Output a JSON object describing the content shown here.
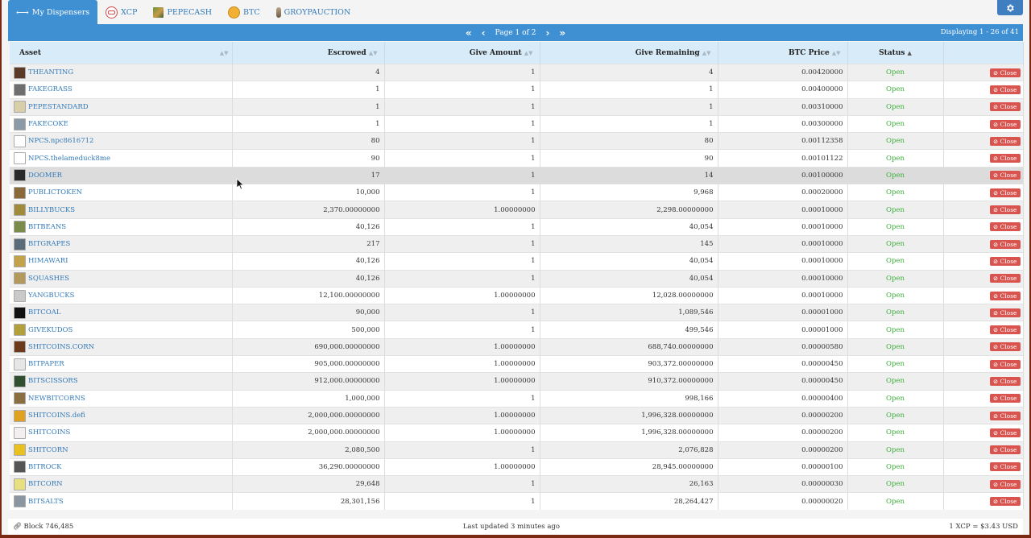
{
  "tabs": [
    {
      "label": "My Dispensers",
      "icon": "arrows-icon",
      "active": true
    },
    {
      "label": "XCP",
      "icon": "xcp-icon"
    },
    {
      "label": "PEPECASH",
      "icon": "pepecash-icon"
    },
    {
      "label": "BTC",
      "icon": "btc-icon"
    },
    {
      "label": "GROYPAUCTION",
      "icon": "groypauction-icon"
    }
  ],
  "pager": {
    "page_label": "Page 1 of 2",
    "displaying": "Displaying 1 - 26 of 41"
  },
  "columns": [
    "Asset",
    "Escrowed",
    "Give Amount",
    "Give Remaining",
    "BTC Price",
    "Status"
  ],
  "close_label": "Close",
  "rows": [
    {
      "asset": "THEANTING",
      "escrowed": "4",
      "give": "1",
      "remaining": "4",
      "price": "0.00420000",
      "status": "Open",
      "color": "#5b3a28"
    },
    {
      "asset": "FAKEGRASS",
      "escrowed": "1",
      "give": "1",
      "remaining": "1",
      "price": "0.00400000",
      "status": "Open",
      "color": "#6e6e6e"
    },
    {
      "asset": "PEPESTANDARD",
      "escrowed": "1",
      "give": "1",
      "remaining": "1",
      "price": "0.00310000",
      "status": "Open",
      "color": "#d8cfa8"
    },
    {
      "asset": "FAKECOKE",
      "escrowed": "1",
      "give": "1",
      "remaining": "1",
      "price": "0.00300000",
      "status": "Open",
      "color": "#8a9aa6"
    },
    {
      "asset": "NPCS.npc8616712",
      "escrowed": "80",
      "give": "1",
      "remaining": "80",
      "price": "0.00112358",
      "status": "Open",
      "color": "#ffffff"
    },
    {
      "asset": "NPCS.thelameduck8me",
      "escrowed": "90",
      "give": "1",
      "remaining": "90",
      "price": "0.00101122",
      "status": "Open",
      "color": "#ffffff"
    },
    {
      "asset": "DOOMER",
      "escrowed": "17",
      "give": "1",
      "remaining": "14",
      "price": "0.00100000",
      "status": "Open",
      "color": "#2a2a2a"
    },
    {
      "asset": "PUBLICTOKEN",
      "escrowed": "10,000",
      "give": "1",
      "remaining": "9,968",
      "price": "0.00020000",
      "status": "Open",
      "color": "#8b6a3a"
    },
    {
      "asset": "BILLYBUCKS",
      "escrowed": "2,370.00000000",
      "give": "1.00000000",
      "remaining": "2,298.00000000",
      "price": "0.00010000",
      "status": "Open",
      "color": "#a08a3c"
    },
    {
      "asset": "BITBEANS",
      "escrowed": "40,126",
      "give": "1",
      "remaining": "40,054",
      "price": "0.00010000",
      "status": "Open",
      "color": "#7b8c4a"
    },
    {
      "asset": "BITGRAPES",
      "escrowed": "217",
      "give": "1",
      "remaining": "145",
      "price": "0.00010000",
      "status": "Open",
      "color": "#5a6b7a"
    },
    {
      "asset": "HIMAWARI",
      "escrowed": "40,126",
      "give": "1",
      "remaining": "40,054",
      "price": "0.00010000",
      "status": "Open",
      "color": "#c4a24a"
    },
    {
      "asset": "SQUASHES",
      "escrowed": "40,126",
      "give": "1",
      "remaining": "40,054",
      "price": "0.00010000",
      "status": "Open",
      "color": "#b49a5a"
    },
    {
      "asset": "YANGBUCKS",
      "escrowed": "12,100.00000000",
      "give": "1.00000000",
      "remaining": "12,028.00000000",
      "price": "0.00010000",
      "status": "Open",
      "color": "#c9c9c9"
    },
    {
      "asset": "BITCOAL",
      "escrowed": "90,000",
      "give": "1",
      "remaining": "1,089,546",
      "price": "0.00001000",
      "status": "Open",
      "color": "#111111"
    },
    {
      "asset": "GIVEKUDOS",
      "escrowed": "500,000",
      "give": "1",
      "remaining": "499,546",
      "price": "0.00001000",
      "status": "Open",
      "color": "#b2a03a"
    },
    {
      "asset": "SHITCOINS.CORN",
      "escrowed": "690,000.00000000",
      "give": "1.00000000",
      "remaining": "688,740.00000000",
      "price": "0.00000580",
      "status": "Open",
      "color": "#6b3a1a"
    },
    {
      "asset": "BITPAPER",
      "escrowed": "905,000.00000000",
      "give": "1.00000000",
      "remaining": "903,372.00000000",
      "price": "0.00000450",
      "status": "Open",
      "color": "#e6e6e6"
    },
    {
      "asset": "BITSCISSORS",
      "escrowed": "912,000.00000000",
      "give": "1.00000000",
      "remaining": "910,372.00000000",
      "price": "0.00000450",
      "status": "Open",
      "color": "#2f4f2f"
    },
    {
      "asset": "NEWBITCORNS",
      "escrowed": "1,000,000",
      "give": "1",
      "remaining": "998,166",
      "price": "0.00000400",
      "status": "Open",
      "color": "#8a7040"
    },
    {
      "asset": "SHITCOINS.defi",
      "escrowed": "2,000,000.00000000",
      "give": "1.00000000",
      "remaining": "1,996,328.00000000",
      "price": "0.00000200",
      "status": "Open",
      "color": "#e0a020"
    },
    {
      "asset": "SHITCOINS",
      "escrowed": "2,000,000.00000000",
      "give": "1.00000000",
      "remaining": "1,996,328.00000000",
      "price": "0.00000200",
      "status": "Open",
      "color": "#f3eef0"
    },
    {
      "asset": "SHITCORN",
      "escrowed": "2,080,500",
      "give": "1",
      "remaining": "2,076,828",
      "price": "0.00000200",
      "status": "Open",
      "color": "#e8c020"
    },
    {
      "asset": "BITROCK",
      "escrowed": "36,290.00000000",
      "give": "1.00000000",
      "remaining": "28,945.00000000",
      "price": "0.00000100",
      "status": "Open",
      "color": "#555555"
    },
    {
      "asset": "BITCORN",
      "escrowed": "29,648",
      "give": "1",
      "remaining": "26,163",
      "price": "0.00000030",
      "status": "Open",
      "color": "#e8e080"
    },
    {
      "asset": "BITSALTS",
      "escrowed": "28,301,156",
      "give": "1",
      "remaining": "28,264,427",
      "price": "0.00000020",
      "status": "Open",
      "color": "#8a96a0"
    }
  ],
  "footer": {
    "block": "Block 746,485",
    "updated": "Last updated 3 minutes ago",
    "rate": "1 XCP = $3.43 USD"
  }
}
